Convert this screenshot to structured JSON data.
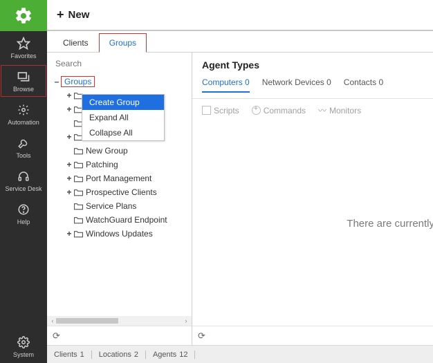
{
  "sidebar": {
    "items": [
      {
        "label": "Favorites"
      },
      {
        "label": "Browse"
      },
      {
        "label": "Automation"
      },
      {
        "label": "Tools"
      },
      {
        "label": "Service Desk"
      },
      {
        "label": "Help"
      }
    ],
    "system_label": "System"
  },
  "topbar": {
    "new_label": "New"
  },
  "tabs": {
    "clients": "Clients",
    "groups": "Groups"
  },
  "search": {
    "placeholder": "Search"
  },
  "tree": {
    "root": "Groups",
    "children": [
      {
        "label": "",
        "expandable": true
      },
      {
        "label": "",
        "expandable": true
      },
      {
        "label": "",
        "expandable": false
      },
      {
        "label": "",
        "expandable": true
      },
      {
        "label": "New Group",
        "expandable": false
      },
      {
        "label": "Patching",
        "expandable": true
      },
      {
        "label": "Port Management",
        "expandable": true
      },
      {
        "label": "Prospective Clients",
        "expandable": true
      },
      {
        "label": "Service Plans",
        "expandable": false
      },
      {
        "label": "WatchGuard Endpoint",
        "expandable": false
      },
      {
        "label": "Windows Updates",
        "expandable": true
      }
    ]
  },
  "context_menu": {
    "create_group": "Create Group",
    "expand_all": "Expand All",
    "collapse_all": "Collapse All"
  },
  "agent": {
    "title": "Agent Types",
    "tabs": {
      "computers": "Computers",
      "computers_count": "0",
      "network": "Network Devices",
      "network_count": "0",
      "contacts": "Contacts",
      "contacts_count": "0"
    },
    "actions": {
      "scripts": "Scripts",
      "commands": "Commands",
      "monitors": "Monitors"
    },
    "body_text": "There are currently"
  },
  "status": {
    "clients_label": "Clients",
    "clients_n": "1",
    "locations_label": "Locations",
    "locations_n": "2",
    "agents_label": "Agents",
    "agents_n": "12"
  }
}
